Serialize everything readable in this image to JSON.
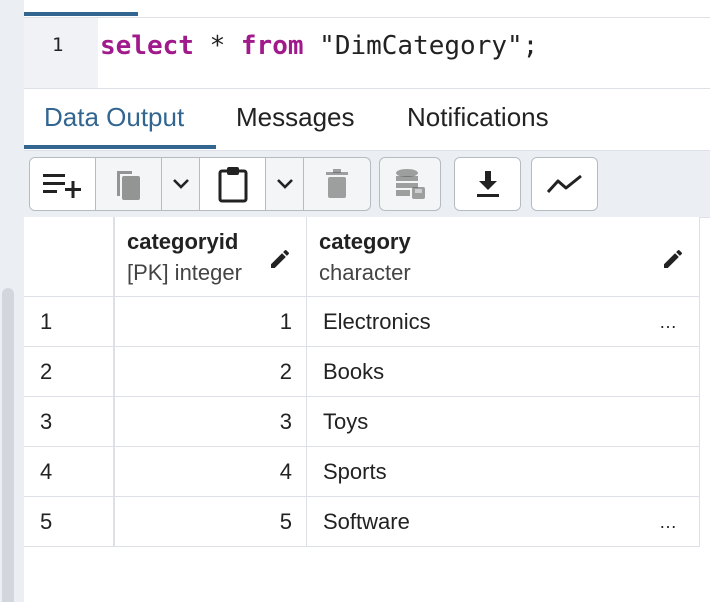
{
  "editor": {
    "line_number": "1",
    "code": {
      "kw1": "select",
      "star": " * ",
      "kw2": "from",
      "rest": " \"DimCategory\";"
    }
  },
  "tabs": [
    {
      "label": "Data Output",
      "active": true
    },
    {
      "label": "Messages",
      "active": false
    },
    {
      "label": "Notifications",
      "active": false
    }
  ],
  "toolbar": {
    "icons": [
      "add-row-icon",
      "copy-icon",
      "chevron-down-icon",
      "paste-icon",
      "chevron-down-icon",
      "delete-icon",
      "save-data-icon",
      "download-icon",
      "graph-visualiser-icon"
    ]
  },
  "grid": {
    "columns": [
      {
        "name": "categoryid",
        "type": "[PK] integer"
      },
      {
        "name": "category",
        "type": "character"
      }
    ],
    "rows": [
      {
        "row": "1",
        "categoryid": "1",
        "category": "Electronics",
        "truncated": "…"
      },
      {
        "row": "2",
        "categoryid": "2",
        "category": "Books",
        "truncated": ""
      },
      {
        "row": "3",
        "categoryid": "3",
        "category": "Toys",
        "truncated": ""
      },
      {
        "row": "4",
        "categoryid": "4",
        "category": "Sports",
        "truncated": ""
      },
      {
        "row": "5",
        "categoryid": "5",
        "category": "Software",
        "truncated": "…"
      }
    ]
  },
  "colors": {
    "accent": "#326690",
    "keyword": "#a01a8c"
  }
}
